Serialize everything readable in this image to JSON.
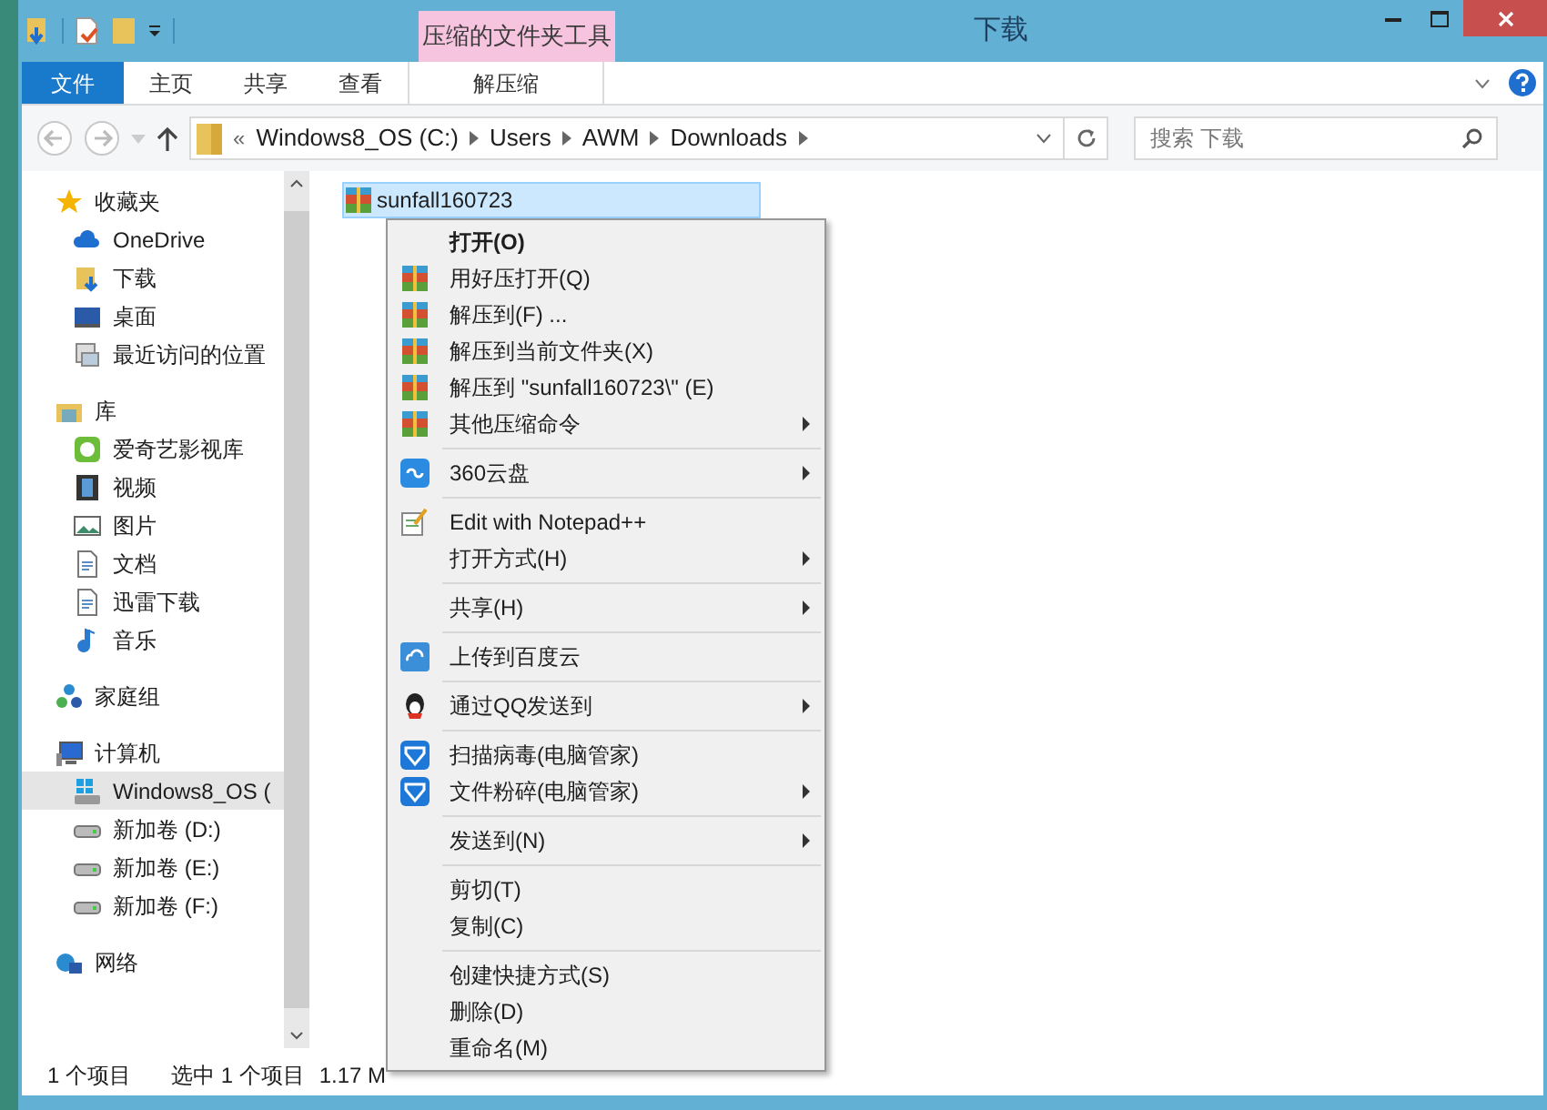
{
  "window": {
    "title": "下载",
    "contextual_group": "压缩的文件夹工具"
  },
  "ribbon_tabs": [
    {
      "label": "文件",
      "kind": "file"
    },
    {
      "label": "主页",
      "kind": "normal"
    },
    {
      "label": "共享",
      "kind": "normal"
    },
    {
      "label": "查看",
      "kind": "normal"
    },
    {
      "label": "解压缩",
      "kind": "contextual"
    }
  ],
  "address_bar": {
    "overflow": "«",
    "segments": [
      "Windows8_OS (C:)",
      "Users",
      "AWM",
      "Downloads"
    ]
  },
  "search": {
    "placeholder": "搜索 下载"
  },
  "navigation": [
    {
      "label": "收藏夹",
      "selected": false,
      "children": [
        {
          "label": "OneDrive",
          "selected": false
        },
        {
          "label": "下载",
          "selected": false
        },
        {
          "label": "桌面",
          "selected": false
        },
        {
          "label": "最近访问的位置",
          "selected": false
        }
      ]
    },
    {
      "label": "库",
      "selected": false,
      "children": [
        {
          "label": "爱奇艺影视库",
          "selected": false
        },
        {
          "label": "视频",
          "selected": false
        },
        {
          "label": "图片",
          "selected": false
        },
        {
          "label": "文档",
          "selected": false
        },
        {
          "label": "迅雷下载",
          "selected": false
        },
        {
          "label": "音乐",
          "selected": false
        }
      ]
    },
    {
      "label": "家庭组",
      "selected": false
    },
    {
      "label": "计算机",
      "selected": false,
      "children": [
        {
          "label": "Windows8_OS (",
          "selected": true
        },
        {
          "label": "新加卷 (D:)",
          "selected": false
        },
        {
          "label": "新加卷 (E:)",
          "selected": false
        },
        {
          "label": "新加卷 (F:)",
          "selected": false
        }
      ]
    },
    {
      "label": "网络",
      "selected": false
    }
  ],
  "files": [
    {
      "name": "sunfall160723",
      "selected": true
    }
  ],
  "status_bar": {
    "item_count": "1 个项目",
    "selection": "选中 1 个项目",
    "size": "1.17 M"
  },
  "context_menu": [
    {
      "kind": "item",
      "label": "打开(O)",
      "default": true,
      "submenu": false
    },
    {
      "kind": "item",
      "label": "用好压打开(Q)",
      "default": false,
      "submenu": false
    },
    {
      "kind": "item",
      "label": "解压到(F) ...",
      "default": false,
      "submenu": false
    },
    {
      "kind": "item",
      "label": "解压到当前文件夹(X)",
      "default": false,
      "submenu": false
    },
    {
      "kind": "item",
      "label": "解压到 \"sunfall160723\\\" (E)",
      "default": false,
      "submenu": false
    },
    {
      "kind": "item",
      "label": "其他压缩命令",
      "default": false,
      "submenu": true
    },
    {
      "kind": "separator"
    },
    {
      "kind": "item",
      "label": "360云盘",
      "default": false,
      "submenu": true
    },
    {
      "kind": "separator"
    },
    {
      "kind": "item",
      "label": "Edit with Notepad++",
      "default": false,
      "submenu": false
    },
    {
      "kind": "item",
      "label": "打开方式(H)",
      "default": false,
      "submenu": true
    },
    {
      "kind": "separator"
    },
    {
      "kind": "item",
      "label": "共享(H)",
      "default": false,
      "submenu": true
    },
    {
      "kind": "separator"
    },
    {
      "kind": "item",
      "label": "上传到百度云",
      "default": false,
      "submenu": false
    },
    {
      "kind": "separator"
    },
    {
      "kind": "item",
      "label": "通过QQ发送到",
      "default": false,
      "submenu": true
    },
    {
      "kind": "separator"
    },
    {
      "kind": "item",
      "label": "扫描病毒(电脑管家)",
      "default": false,
      "submenu": false
    },
    {
      "kind": "item",
      "label": "文件粉碎(电脑管家)",
      "default": false,
      "submenu": true
    },
    {
      "kind": "separator"
    },
    {
      "kind": "item",
      "label": "发送到(N)",
      "default": false,
      "submenu": true
    },
    {
      "kind": "separator"
    },
    {
      "kind": "item",
      "label": "剪切(T)",
      "default": false,
      "submenu": false
    },
    {
      "kind": "item",
      "label": "复制(C)",
      "default": false,
      "submenu": false
    },
    {
      "kind": "separator"
    },
    {
      "kind": "item",
      "label": "创建快捷方式(S)",
      "default": false,
      "submenu": false
    },
    {
      "kind": "item",
      "label": "删除(D)",
      "default": false,
      "submenu": false
    },
    {
      "kind": "item",
      "label": "重命名(M)",
      "default": false,
      "submenu": false
    }
  ]
}
